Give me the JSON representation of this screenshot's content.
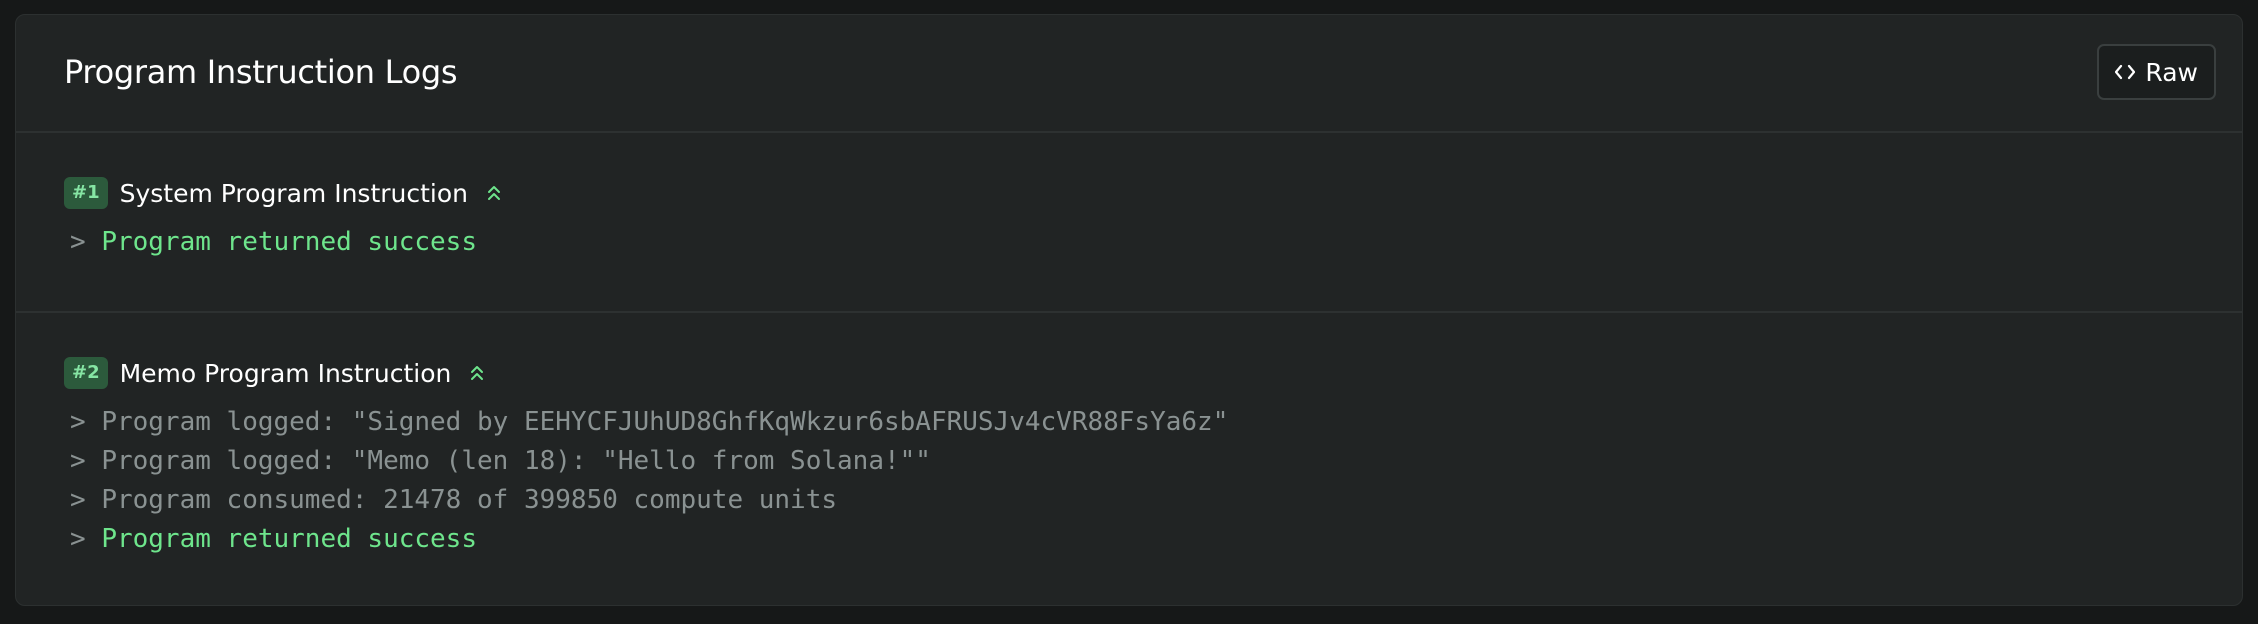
{
  "header": {
    "title": "Program Instruction Logs",
    "raw_button_label": "Raw",
    "raw_button_icon": "code-brackets-icon"
  },
  "colors": {
    "card_bg": "#212424",
    "page_bg": "#161818",
    "success_green": "#6ee58c",
    "badge_bg": "#2c5a3c",
    "badge_text": "#86e5a4",
    "log_gray": "#8a9292"
  },
  "instructions": [
    {
      "badge": "#1",
      "name": "System Program Instruction",
      "collapse_icon": "chevrons-up-icon",
      "logs": [
        {
          "prompt": ">",
          "text": "Program returned success",
          "style": "success"
        }
      ]
    },
    {
      "badge": "#2",
      "name": "Memo Program Instruction",
      "collapse_icon": "chevrons-up-icon",
      "logs": [
        {
          "prompt": ">",
          "text": "Program logged: \"Signed by EEHYCFJUhUD8GhfKqWkzur6sbAFRUSJv4cVR88FsYa6z\"",
          "style": "info"
        },
        {
          "prompt": ">",
          "text": "Program logged: \"Memo (len 18): \"Hello from Solana!\"\"",
          "style": "info"
        },
        {
          "prompt": ">",
          "text": "Program consumed: 21478 of 399850 compute units",
          "style": "info"
        },
        {
          "prompt": ">",
          "text": "Program returned success",
          "style": "success"
        }
      ]
    }
  ]
}
